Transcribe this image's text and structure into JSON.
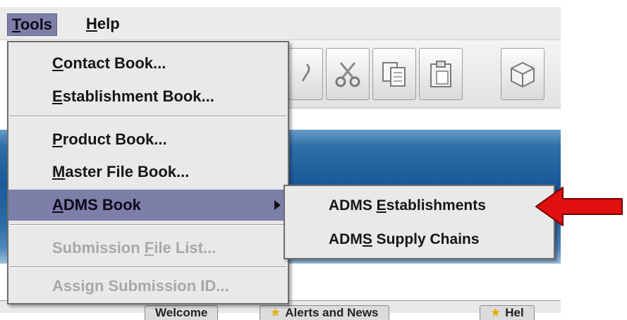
{
  "menubar": {
    "tools": {
      "accel": "T",
      "rest": "ools"
    },
    "help": {
      "accel": "H",
      "rest": "elp"
    }
  },
  "dropdown": {
    "items": [
      {
        "pre": "",
        "accel": "C",
        "post": "ontact Book...",
        "enabled": true
      },
      {
        "pre": "",
        "accel": "E",
        "post": "stablishment Book...",
        "enabled": true
      },
      {
        "pre": "",
        "accel": "P",
        "post": "roduct Book...",
        "enabled": true
      },
      {
        "pre": "",
        "accel": "M",
        "post": "aster File Book...",
        "enabled": true
      },
      {
        "pre": "",
        "accel": "A",
        "post": "DMS Book",
        "enabled": true,
        "selected": true,
        "has_submenu": true
      },
      {
        "pre": "Submission ",
        "accel": "F",
        "post": "ile List...",
        "enabled": false
      },
      {
        "pre": "Assi",
        "accel": "g",
        "post": "n Submission ID...",
        "enabled": false
      }
    ]
  },
  "submenu": {
    "items": [
      {
        "pre": "ADMS ",
        "accel": "E",
        "post": "stablishments"
      },
      {
        "pre": "ADM",
        "accel": "S",
        "post": " Supply Chains"
      }
    ]
  },
  "tabs": {
    "welcome": "Welcome",
    "alerts": "Alerts and News",
    "help": "Hel"
  },
  "toolbar": {
    "icons": [
      "paste-partial-icon",
      "cut-icon",
      "copy-icon",
      "paste-icon",
      "package-icon"
    ]
  },
  "colors": {
    "menu_highlight": "#7d7fa8",
    "menu_bg": "#e9e9e9",
    "pointer_arrow": "#e0100f",
    "app_blue": "#1a5a98"
  }
}
